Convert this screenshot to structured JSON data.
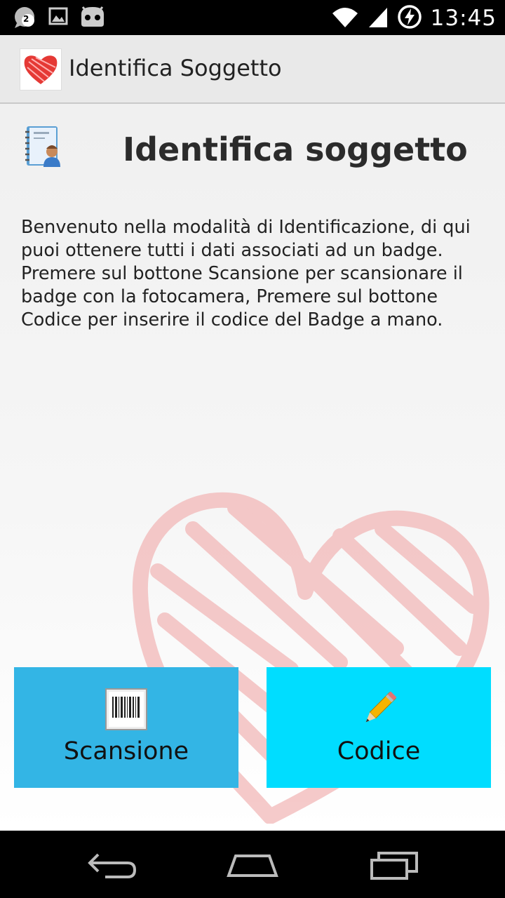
{
  "status_bar": {
    "time": "13:45",
    "notification_count": "2",
    "icons": [
      "chat-notification-icon",
      "image-icon",
      "android-icon",
      "wifi-icon",
      "signal-icon",
      "battery-charging-icon"
    ]
  },
  "action_bar": {
    "title": "Identifica Soggetto",
    "icon": "heart-app-icon"
  },
  "main": {
    "title": "Identifica soggetto",
    "title_icon": "contact-book-icon",
    "description": "Benvenuto nella modalità di Identificazione, di qui puoi ottenere tutti i dati associati ad un badge. Premere sul bottone Scansione per scansionare il badge con la fotocamera, Premere sul bottone Codice per inserire il codice del Badge a mano.",
    "buttons": [
      {
        "label": "Scansione",
        "icon": "barcode-icon",
        "color": "#33b5e5"
      },
      {
        "label": "Codice",
        "icon": "pencil-icon",
        "color": "#00ddff"
      }
    ]
  },
  "nav_bar": {
    "buttons": [
      "back-icon",
      "home-icon",
      "recent-apps-icon"
    ]
  }
}
